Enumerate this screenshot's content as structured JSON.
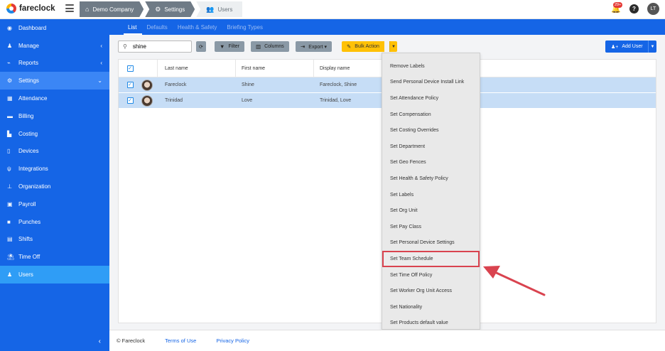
{
  "brand": {
    "name": "fareclock"
  },
  "breadcrumbs": [
    {
      "label": "Demo Company",
      "icon": "home-icon"
    },
    {
      "label": "Settings",
      "icon": "gear-icon"
    },
    {
      "label": "Users",
      "icon": "users-icon"
    }
  ],
  "topbar": {
    "notifications_badge": "29+",
    "help": "?",
    "avatar_initials": "LT"
  },
  "sidebar": {
    "items": [
      {
        "label": "Dashboard",
        "icon": "dashboard-icon",
        "chevron": ""
      },
      {
        "label": "Manage",
        "icon": "user-icon",
        "chevron": "‹"
      },
      {
        "label": "Reports",
        "icon": "chart-icon",
        "chevron": "‹"
      },
      {
        "label": "Settings",
        "icon": "gear-icon",
        "chevron": "⌄"
      },
      {
        "label": "Attendance",
        "icon": "attendance-icon",
        "chevron": ""
      },
      {
        "label": "Billing",
        "icon": "billing-icon",
        "chevron": ""
      },
      {
        "label": "Costing",
        "icon": "costing-icon",
        "chevron": ""
      },
      {
        "label": "Devices",
        "icon": "device-icon",
        "chevron": ""
      },
      {
        "label": "Integrations",
        "icon": "plug-icon",
        "chevron": ""
      },
      {
        "label": "Organization",
        "icon": "org-icon",
        "chevron": ""
      },
      {
        "label": "Payroll",
        "icon": "payroll-icon",
        "chevron": ""
      },
      {
        "label": "Punches",
        "icon": "punches-icon",
        "chevron": ""
      },
      {
        "label": "Shifts",
        "icon": "calendar-icon",
        "chevron": ""
      },
      {
        "label": "Time Off",
        "icon": "beach-icon",
        "chevron": ""
      },
      {
        "label": "Users",
        "icon": "users-icon",
        "chevron": ""
      }
    ],
    "collapse": "‹"
  },
  "tabs": [
    "List",
    "Defaults",
    "Health & Safety",
    "Briefing Types"
  ],
  "toolbar": {
    "search_value": "shine",
    "refresh": "⟳",
    "filter": "Filter",
    "columns": "Columns",
    "export": "Export ▾",
    "bulk_action": "Bulk Action",
    "add_user": "Add User"
  },
  "table": {
    "headers": [
      "Last name",
      "First name",
      "Display name"
    ],
    "rows": [
      {
        "last": "Fareclock",
        "first": "Shine",
        "display": "Fareclock, Shine"
      },
      {
        "last": "Trinidad",
        "first": "Love",
        "display": "Trinidad, Love"
      }
    ]
  },
  "bulk_menu": {
    "items": [
      "Remove Labels",
      "Send Personal Device Install Link",
      "Set Attendance Policy",
      "Set Compensation",
      "Set Costing Overrides",
      "Set Department",
      "Set Geo Fences",
      "Set Health & Safety Policy",
      "Set Labels",
      "Set Org Unit",
      "Set Pay Class",
      "Set Personal Device Settings",
      "Set Team Schedule",
      "Set Time Off Policy",
      "Set Worker Org Unit Access",
      "Set Nationality",
      "Set Products default value"
    ],
    "highlighted_index": 12
  },
  "footer": {
    "copyright": "© Fareclock",
    "terms": "Terms of Use",
    "privacy": "Privacy Policy"
  },
  "colors": {
    "primary": "#1565e6",
    "bulk": "#ffc107",
    "highlight": "#d9434f",
    "row_selected": "#c6ddf6"
  }
}
